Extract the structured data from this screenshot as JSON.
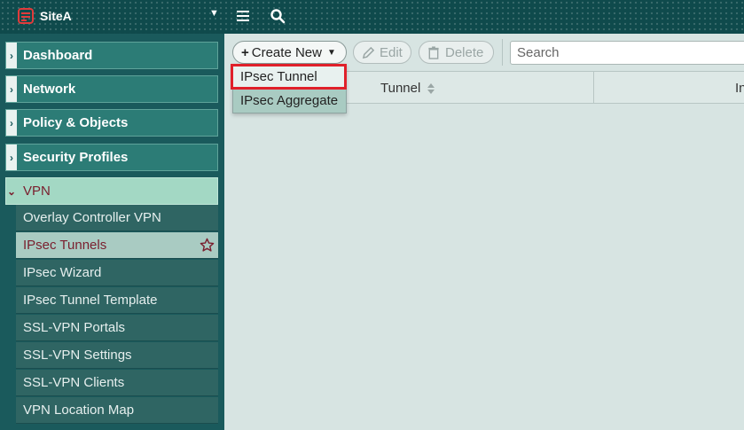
{
  "topbar": {
    "site_name": "SiteA",
    "icons": [
      "fortigate-logo-icon",
      "chevron-down-icon",
      "hamburger-menu-icon",
      "search-icon"
    ]
  },
  "sidebar": {
    "sections": [
      {
        "label": "Dashboard",
        "expanded": false
      },
      {
        "label": "Network",
        "expanded": false
      },
      {
        "label": "Policy & Objects",
        "expanded": false
      },
      {
        "label": "Security Profiles",
        "expanded": false
      },
      {
        "label": "VPN",
        "expanded": true
      }
    ],
    "vpn_items": [
      {
        "label": "Overlay Controller VPN"
      },
      {
        "label": "IPsec Tunnels",
        "active": true
      },
      {
        "label": "IPsec Wizard"
      },
      {
        "label": "IPsec Tunnel Template"
      },
      {
        "label": "SSL-VPN Portals"
      },
      {
        "label": "SSL-VPN Settings"
      },
      {
        "label": "SSL-VPN Clients"
      },
      {
        "label": "VPN Location Map"
      }
    ]
  },
  "toolbar": {
    "create_new_label": "Create New",
    "edit_label": "Edit",
    "delete_label": "Delete",
    "search_placeholder": "Search"
  },
  "table": {
    "columns": [
      "Tunnel",
      "In"
    ]
  },
  "dropdown": {
    "items": [
      "IPsec Tunnel",
      "IPsec Aggregate"
    ],
    "highlighted_item": "IPsec Tunnel"
  },
  "colors": {
    "topbar": "#0f4a4c",
    "sidebar": "#1a5a5c",
    "nav_section": "#2c7c76",
    "active_item": "#a9cbc2",
    "content_bg": "#d7e4e2",
    "highlight": "#e0202a",
    "active_text": "#7a1f2e"
  }
}
